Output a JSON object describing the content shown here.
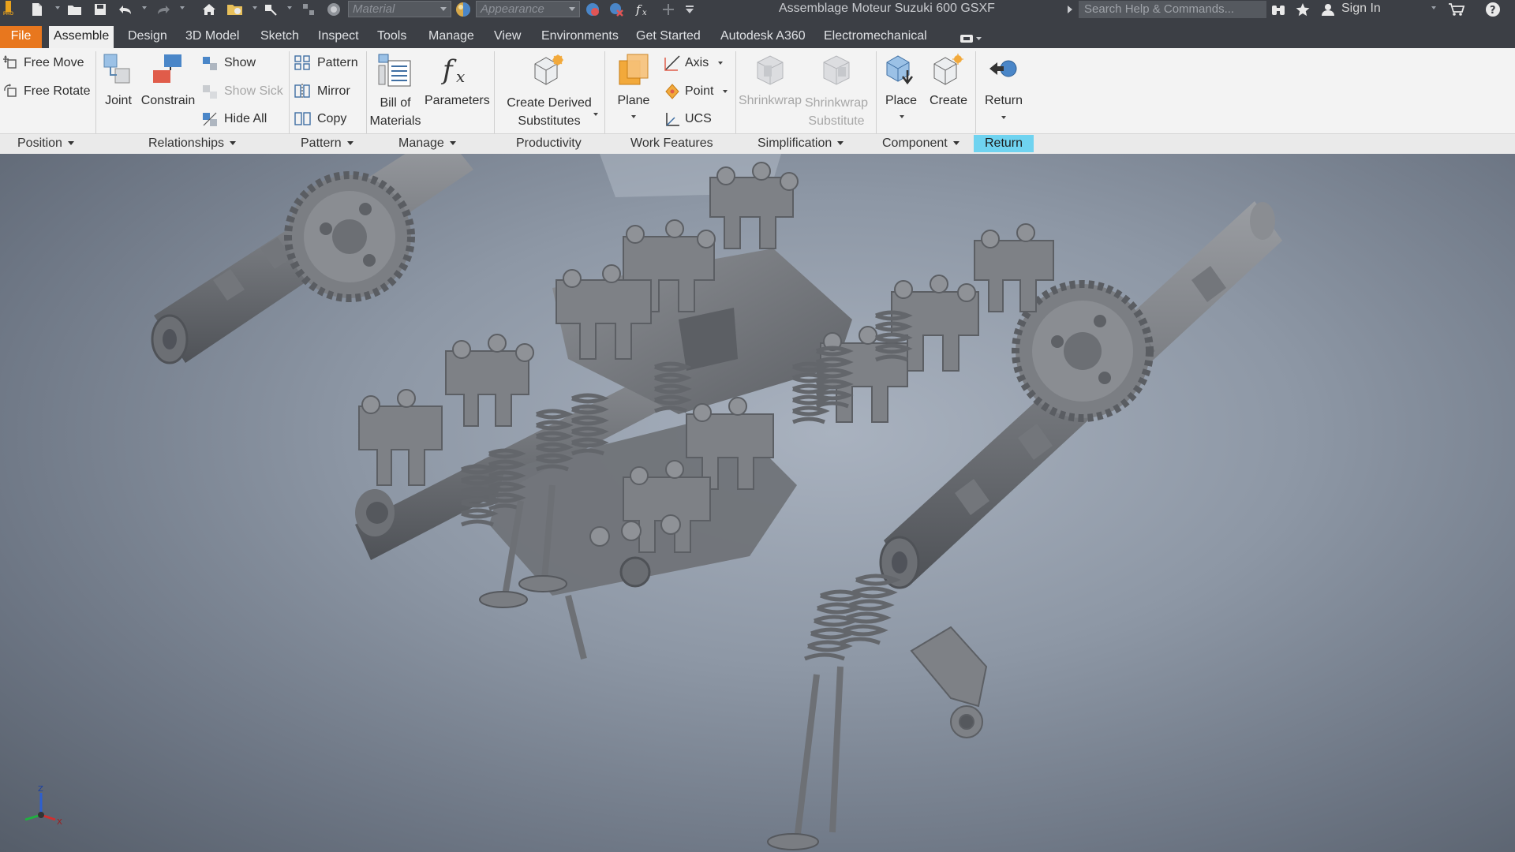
{
  "window": {
    "title": "Assemblage Moteur Suzuki 600 GSXF",
    "search_placeholder": "Search Help & Commands...",
    "sign_in": "Sign In",
    "material_placeholder": "Material",
    "appearance_placeholder": "Appearance"
  },
  "tabs": [
    {
      "label": "File"
    },
    {
      "label": "Assemble"
    },
    {
      "label": "Design"
    },
    {
      "label": "3D Model"
    },
    {
      "label": "Sketch"
    },
    {
      "label": "Inspect"
    },
    {
      "label": "Tools"
    },
    {
      "label": "Manage"
    },
    {
      "label": "View"
    },
    {
      "label": "Environments"
    },
    {
      "label": "Get Started"
    },
    {
      "label": "Autodesk A360"
    },
    {
      "label": "Electromechanical"
    }
  ],
  "ribbon": {
    "position": {
      "free_move": "Free Move",
      "free_rotate": "Free Rotate",
      "label": "Position"
    },
    "relationships": {
      "joint": "Joint",
      "constrain": "Constrain",
      "show": "Show",
      "show_sick": "Show Sick",
      "hide_all": "Hide All",
      "label": "Relationships"
    },
    "pattern": {
      "pattern": "Pattern",
      "mirror": "Mirror",
      "copy": "Copy",
      "label": "Pattern"
    },
    "manage": {
      "bom_line1": "Bill of",
      "bom_line2": "Materials",
      "parameters": "Parameters",
      "label": "Manage"
    },
    "productivity": {
      "cds_line1": "Create Derived",
      "cds_line2": "Substitutes",
      "label": "Productivity"
    },
    "work_features": {
      "plane": "Plane",
      "axis": "Axis",
      "point": "Point",
      "ucs": "UCS",
      "label": "Work Features"
    },
    "simplification": {
      "shrinkwrap": "Shrinkwrap",
      "sws_line1": "Shrinkwrap",
      "sws_line2": "Substitute",
      "label": "Simplification"
    },
    "component": {
      "place": "Place",
      "create": "Create",
      "label": "Component"
    },
    "return": {
      "button": "Return",
      "label": "Return"
    }
  },
  "triad": {
    "z": "Z",
    "x": "X"
  },
  "colors": {
    "file_tab": "#e8771e",
    "return_highlight": "#6fd3f0",
    "titlebar": "#3c3f45",
    "ribbon": "#f3f3f3",
    "part_gray": "#7c7f84"
  }
}
